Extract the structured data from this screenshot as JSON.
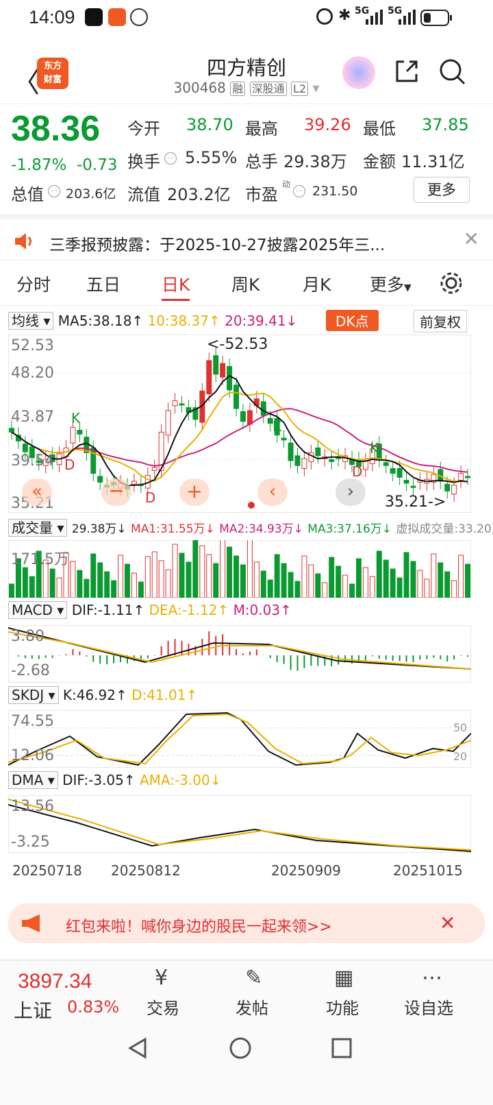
{
  "status": {
    "time": "14:09",
    "net1": "5G",
    "net2": "5G"
  },
  "header": {
    "title": "四方精创",
    "code": "300468",
    "tag1": "融",
    "tag2": "深股通",
    "tag3": "L2",
    "logo_line1": "东方",
    "logo_line2": "财富"
  },
  "quote": {
    "price": "38.36",
    "change_pct": "-1.87%",
    "change": "-0.73",
    "open_label": "今开",
    "open": "38.70",
    "high_label": "最高",
    "high": "39.26",
    "low_label": "最低",
    "low": "37.85",
    "turnover_label": "换手",
    "turnover": "5.55%",
    "volume_label": "总手",
    "volume": "29.38万",
    "amount_label": "金额",
    "amount": "11.31亿",
    "mcap_label": "总值",
    "mcap": "203.6亿",
    "float_label": "流值",
    "float": "203.2亿",
    "pe_label": "市盈",
    "pe_sup": "动",
    "pe": "231.50",
    "more": "更多"
  },
  "notice": {
    "text": "三季报预披露：于2025-10-27披露2025年三..."
  },
  "tabs": [
    "分时",
    "五日",
    "日K",
    "周K",
    "月K",
    "更多"
  ],
  "active_tab": 2,
  "kline": {
    "ma_select": "均线",
    "ma5": "MA5:38.18↑",
    "ma10": "10:38.37↑",
    "ma20": "20:39.41↓",
    "dk": "DK点",
    "fq": "前复权",
    "y_labels": [
      "52.53",
      "48.20",
      "43.87",
      "39.54",
      "35.21"
    ],
    "max_label": "<-52.53",
    "min_label": "35.21->"
  },
  "volume": {
    "select": "成交量",
    "v": "29.38万↓",
    "ma1": "MA1:31.55万↓",
    "ma2": "MA2:34.93万↓",
    "ma3": "MA3:37.16万↓",
    "virt": "虚拟成交量:33.20万",
    "max": "171.5万"
  },
  "macd": {
    "select": "MACD",
    "dif": "DIF:-1.11↑",
    "dea": "DEA:-1.12↑",
    "m": "M:0.03↑",
    "top": "3.80",
    "bottom": "-2.68"
  },
  "skdj": {
    "select": "SKDJ",
    "k": "K:46.92↑",
    "d": "D:41.01↑",
    "top": "74.55",
    "bottom": "12.06",
    "l50": "50",
    "l20": "20"
  },
  "dma": {
    "select": "DMA",
    "dif": "DIF:-3.05↑",
    "ama": "AMA:-3.00↓",
    "top": "13.56",
    "bottom": "-3.25"
  },
  "dates": [
    "20250718",
    "20250812",
    "20250909",
    "20251015"
  ],
  "redpacket": {
    "text": "红包来啦！喊你身边的股民一起来领>>"
  },
  "bottom": {
    "index_value": "3897.34",
    "index_name": "上证",
    "index_pct": "0.83%",
    "trade": "交易",
    "post": "发帖",
    "func": "功能",
    "custom": "设自选"
  },
  "colors": {
    "up": "#e03030",
    "down": "#0b9a32",
    "accent": "#ef5a24",
    "ma10": "#e8b000",
    "ma20": "#c8207a"
  }
}
